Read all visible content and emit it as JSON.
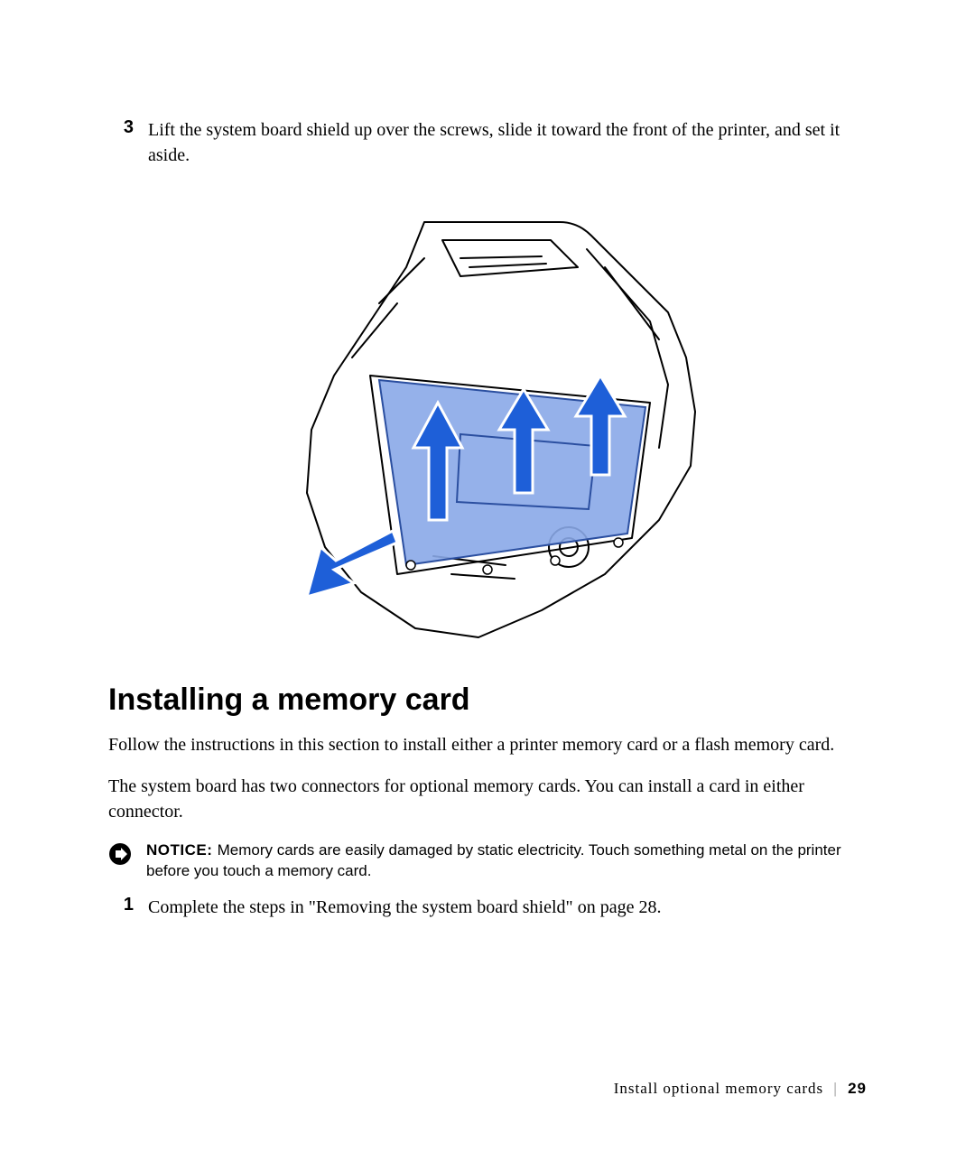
{
  "step3": {
    "num": "3",
    "text": "Lift the system board shield up over the screws, slide it toward the front of the printer, and set it aside."
  },
  "figure_alt": "printer-system-board-shield-removal-illustration",
  "heading": "Installing a memory card",
  "intro1": "Follow the instructions in this section to install either a printer memory card or a flash memory card.",
  "intro2": "The system board has two connectors for optional memory cards. You can install a card in either connector.",
  "notice": {
    "label": "NOTICE: ",
    "text": "Memory cards are easily damaged by static electricity. Touch something metal on the printer before you touch a memory card."
  },
  "step1": {
    "num": "1",
    "text": "Complete the steps in \"Removing the system board shield\" on page 28."
  },
  "footer": {
    "section": "Install optional memory cards",
    "page": "29"
  }
}
